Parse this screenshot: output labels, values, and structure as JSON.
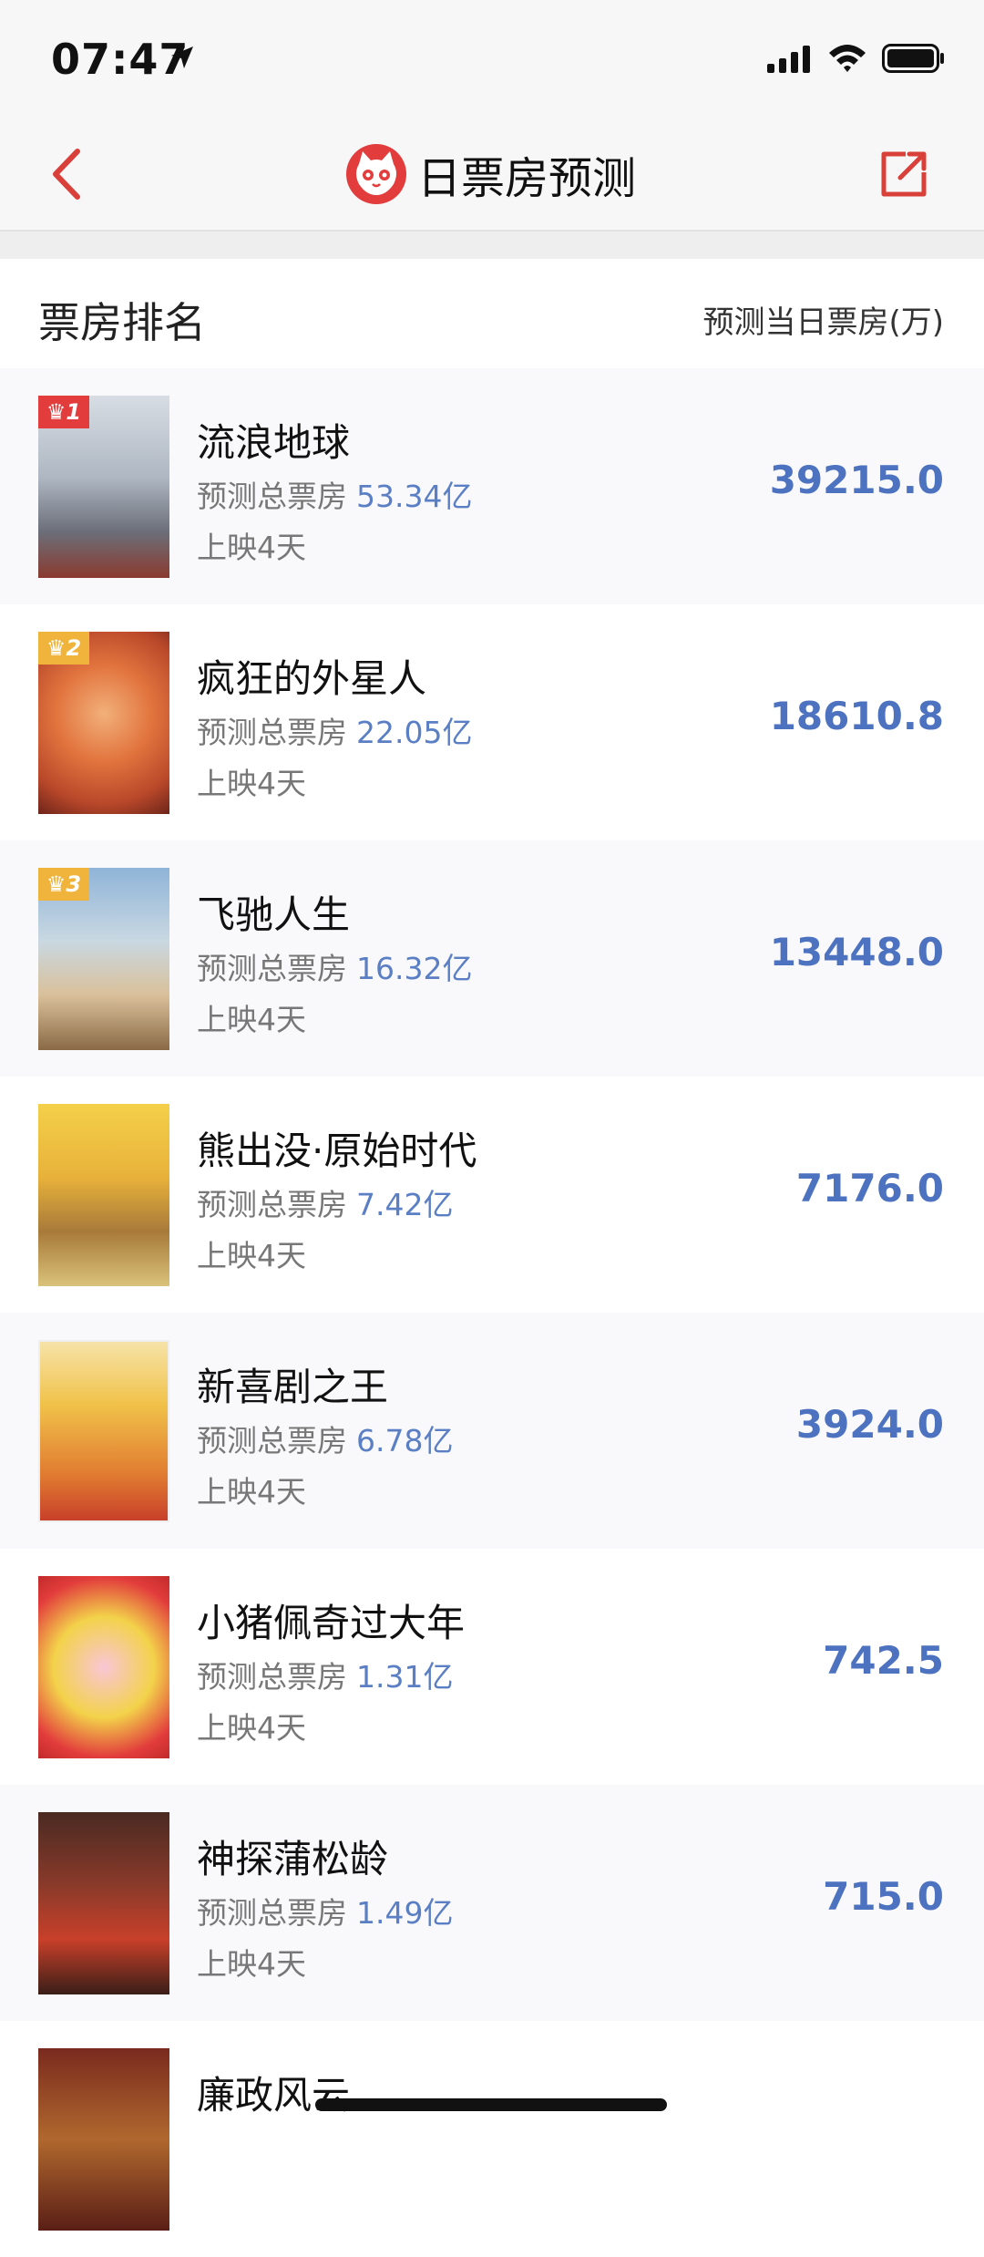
{
  "status_bar": {
    "time": "07:47"
  },
  "nav": {
    "title": "日票房预测"
  },
  "list_header": {
    "title": "票房排名",
    "right_label": "预测当日票房(万)"
  },
  "colors": {
    "accent_red": "#e23c3c",
    "accent_blue": "#4d72c0",
    "gold": "#f0b43c"
  },
  "movies": [
    {
      "rank": "1",
      "name": "流浪地球",
      "predict_label": "预测总票房",
      "predict_value": "53.34亿",
      "days": "上映4天",
      "daily": "39215.0"
    },
    {
      "rank": "2",
      "name": "疯狂的外星人",
      "predict_label": "预测总票房",
      "predict_value": "22.05亿",
      "days": "上映4天",
      "daily": "18610.8"
    },
    {
      "rank": "3",
      "name": "飞驰人生",
      "predict_label": "预测总票房",
      "predict_value": "16.32亿",
      "days": "上映4天",
      "daily": "13448.0"
    },
    {
      "rank": "",
      "name": "熊出没·原始时代",
      "predict_label": "预测总票房",
      "predict_value": "7.42亿",
      "days": "上映4天",
      "daily": "7176.0"
    },
    {
      "rank": "",
      "name": "新喜剧之王",
      "predict_label": "预测总票房",
      "predict_value": "6.78亿",
      "days": "上映4天",
      "daily": "3924.0"
    },
    {
      "rank": "",
      "name": "小猪佩奇过大年",
      "predict_label": "预测总票房",
      "predict_value": "1.31亿",
      "days": "上映4天",
      "daily": "742.5"
    },
    {
      "rank": "",
      "name": "神探蒲松龄",
      "predict_label": "预测总票房",
      "predict_value": "1.49亿",
      "days": "上映4天",
      "daily": "715.0"
    },
    {
      "rank": "",
      "name": "廉政风云",
      "predict_label": "",
      "predict_value": "",
      "days": "",
      "daily": ""
    }
  ]
}
